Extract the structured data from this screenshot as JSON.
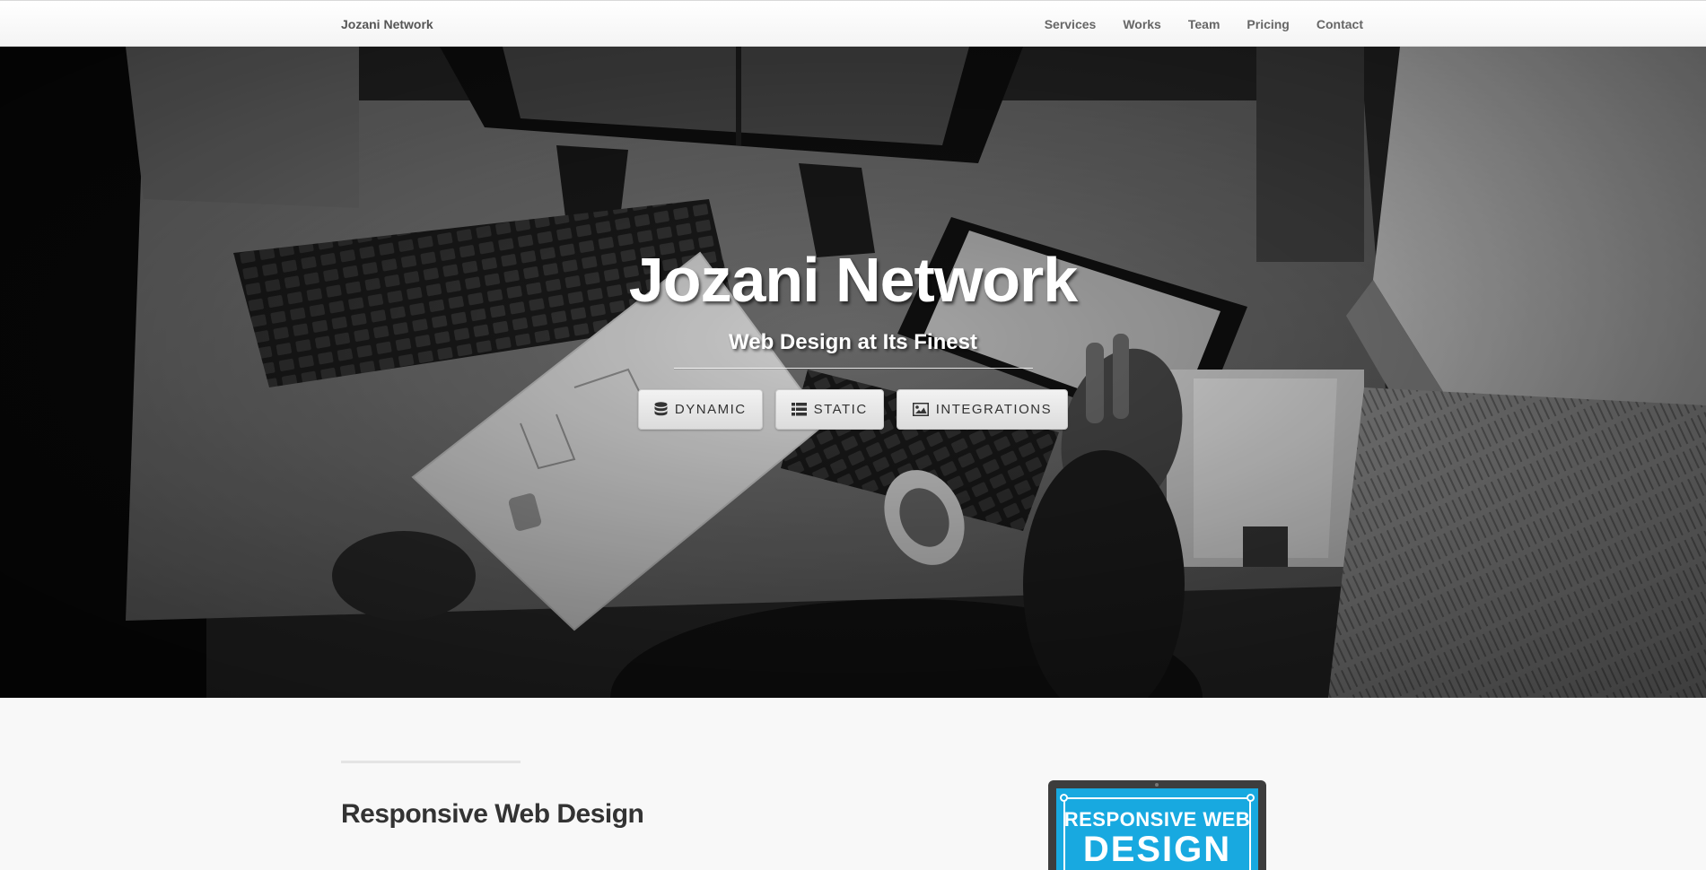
{
  "navbar": {
    "brand": "Jozani Network",
    "links": [
      "Services",
      "Works",
      "Team",
      "Pricing",
      "Contact"
    ]
  },
  "hero": {
    "title": "Jozani Network",
    "subtitle": "Web Design at Its Finest",
    "buttons": [
      {
        "label": "Dynamic",
        "icon": "database-icon"
      },
      {
        "label": "Static",
        "icon": "list-icon"
      },
      {
        "label": "Integrations",
        "icon": "picture-icon"
      }
    ]
  },
  "section": {
    "heading": "Responsive Web Design",
    "image": {
      "line1": "RESPONSIVE WEB",
      "line2": "DESIGN"
    }
  },
  "colors": {
    "navbar_bg": "#ffffff",
    "nav_text": "#666666",
    "hero_text": "#ffffff",
    "button_bg": "#e6e6e6",
    "page_bg": "#f8f8f8",
    "heading_text": "#333333",
    "rwd_blue": "#18a9e0"
  }
}
